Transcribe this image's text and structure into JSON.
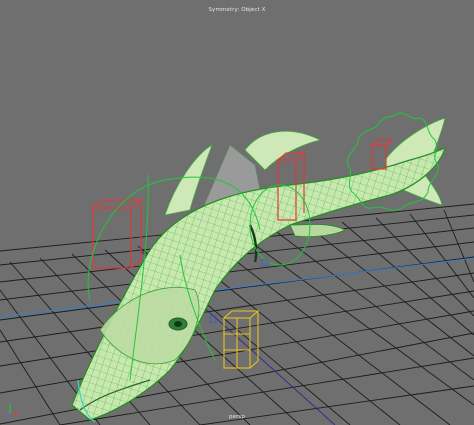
{
  "viewport": {
    "symmetry_label": "Symmetry: Object X",
    "camera_label": "persp",
    "colors": {
      "background": "#6f6f6f",
      "grid": "#1c1c1c",
      "grid_axis_x": "#3a7bd5",
      "grid_axis_z": "#c84040",
      "mesh_fill": "#c9e8b0",
      "mesh_wire": "#3fae3f",
      "selection_wire": "#1f8f1f",
      "control_red": "#e23a3a",
      "control_green": "#1fc83a",
      "control_yellow": "#e6c220",
      "control_cyan": "#40d0c8"
    },
    "icons": [
      "axis-gizmo-icon"
    ],
    "objects": [
      "fish-mesh",
      "dorsal-fin",
      "tail-fin",
      "head-control",
      "spine-controls",
      "jaw-control-yellow"
    ]
  }
}
